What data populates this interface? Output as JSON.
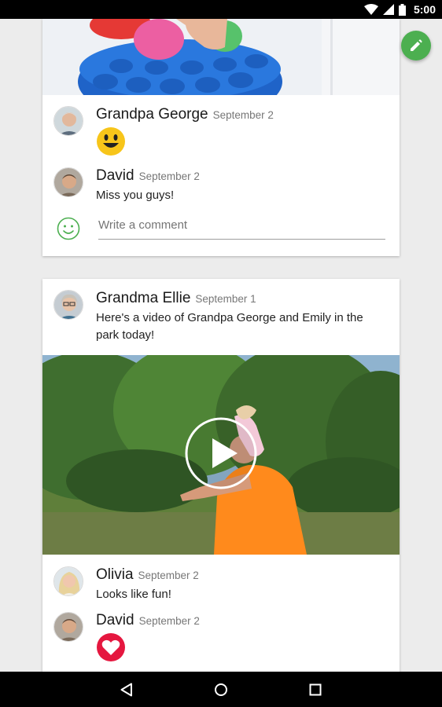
{
  "status_bar": {
    "time": "5:00"
  },
  "posts": [
    {
      "comments": [
        {
          "author": "Grandpa George",
          "date": "September 2",
          "reaction": "smiley-emoji"
        },
        {
          "author": "David",
          "date": "September 2",
          "text": "Miss you guys!"
        }
      ],
      "comment_box": {
        "placeholder": "Write a comment"
      }
    },
    {
      "author": "Grandma Ellie",
      "date": "September 1",
      "text": "Here's a video of Grandpa George and Emily in the park today!",
      "comments": [
        {
          "author": "Olivia",
          "date": "September 2",
          "text": "Looks like fun!"
        },
        {
          "author": "David",
          "date": "September 2",
          "reaction": "heart-emoji"
        }
      ]
    }
  ],
  "colors": {
    "fab": "#4caf50",
    "smiley": "#f7c51a",
    "heart": "#e5173f",
    "comment_icon": "#4caf50"
  }
}
